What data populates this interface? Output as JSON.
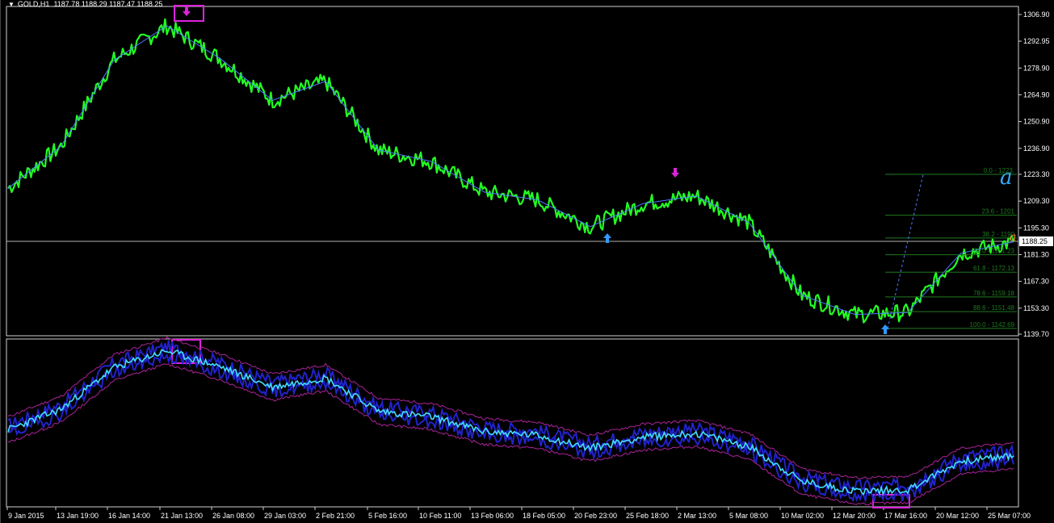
{
  "header": {
    "symbol": "GOLD,H1",
    "quote": "1187.78 1188.29 1187.47 1188.25"
  },
  "price_axis": {
    "ticks": [
      "1306.90",
      "1292.95",
      "1278.90",
      "1264.90",
      "1250.90",
      "1236.90",
      "1223.30",
      "1209.30",
      "1195.30",
      "1181.30",
      "1167.30",
      "1153.30",
      "1139.70"
    ],
    "current": "1188.25"
  },
  "time_axis": {
    "ticks": [
      "9 Jan 2015",
      "13 Jan 19:00",
      "16 Jan 14:00",
      "21 Jan 13:00",
      "26 Jan 08:00",
      "29 Jan 03:00",
      "2 Feb 21:00",
      "5 Feb 16:00",
      "10 Feb 11:00",
      "13 Feb 06:00",
      "18 Feb 05:00",
      "20 Feb 23:00",
      "25 Feb 18:00",
      "2 Mar 13:00",
      "5 Mar 08:00",
      "10 Mar 02:00",
      "12 Mar 20:00",
      "17 Mar 16:00",
      "20 Mar 12:00",
      "25 Mar 07:00"
    ]
  },
  "fibonacci": {
    "levels": [
      {
        "label": "0.0 - 1223.",
        "price": 1223.3
      },
      {
        "label": "23.6 - 1201",
        "price": 1201.9
      },
      {
        "label": "38.2 - 1190",
        "price": 1190.0
      },
      {
        "label": "50.0 - 1181.23",
        "price": 1181.23
      },
      {
        "label": "61.8 - 1172.13",
        "price": 1172.13
      },
      {
        "label": "78.6 - 1159.18",
        "price": 1159.18
      },
      {
        "label": "88.6 - 1151.48",
        "price": 1151.48
      },
      {
        "label": "100.0 - 1142.69",
        "price": 1142.69
      }
    ],
    "color": "#1f7a1f"
  },
  "markers": {
    "wave_label_a": "a",
    "wave_label_a_orange": "a"
  },
  "colors": {
    "background": "#000000",
    "price_line": "#22ff22",
    "zigzag": "#5577ff",
    "osc_line": "#44ddff",
    "osc_band": "#2222cc",
    "osc_envelope": "#aa2299",
    "highlight_box": "#dd22dd",
    "up_arrow": "#3399ff",
    "down_arrow": "#dd22dd",
    "fib_text": "#1f7a1f"
  },
  "chart_data": {
    "type": "line",
    "title": "GOLD,H1",
    "xlabel": "",
    "ylabel": "",
    "ylim": [
      1139.7,
      1310
    ],
    "grid": false,
    "categories": [
      "9 Jan 2015",
      "13 Jan 19:00",
      "16 Jan 14:00",
      "21 Jan 13:00",
      "26 Jan 08:00",
      "29 Jan 03:00",
      "2 Feb 21:00",
      "5 Feb 16:00",
      "10 Feb 11:00",
      "13 Feb 06:00",
      "18 Feb 05:00",
      "20 Feb 23:00",
      "25 Feb 18:00",
      "2 Mar 13:00",
      "5 Mar 08:00",
      "10 Mar 02:00",
      "12 Mar 20:00",
      "17 Mar 16:00",
      "20 Mar 12:00",
      "25 Mar 07:00"
    ],
    "series": [
      {
        "values": [
          1216,
          1238,
          1283,
          1301,
          1284,
          1262,
          1272,
          1236,
          1230,
          1214,
          1210,
          1196,
          1208,
          1212,
          1198,
          1160,
          1150,
          1151,
          1182,
          1188
        ]
      }
    ]
  }
}
